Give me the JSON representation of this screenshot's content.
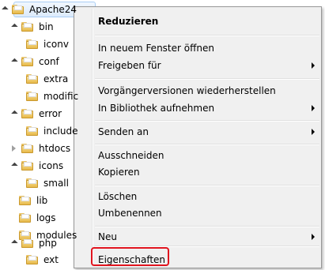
{
  "tree": {
    "items": [
      {
        "label": "Apache24",
        "state": "expanded",
        "selected": true
      },
      {
        "label": "bin",
        "state": "expanded"
      },
      {
        "label": "iconv",
        "state": "none"
      },
      {
        "label": "conf",
        "state": "expanded"
      },
      {
        "label": "extra",
        "state": "none"
      },
      {
        "label": "modific",
        "state": "none"
      },
      {
        "label": "error",
        "state": "expanded"
      },
      {
        "label": "include",
        "state": "none"
      },
      {
        "label": "htdocs",
        "state": "collapsed"
      },
      {
        "label": "icons",
        "state": "expanded"
      },
      {
        "label": "small",
        "state": "none"
      },
      {
        "label": "lib",
        "state": "none"
      },
      {
        "label": "logs",
        "state": "none"
      },
      {
        "label": "modules",
        "state": "none"
      },
      {
        "label": "php",
        "state": "expanded"
      },
      {
        "label": "ext",
        "state": "none"
      }
    ]
  },
  "menu": {
    "items": [
      {
        "label": "Reduzieren",
        "bold": true
      },
      {
        "label": "In neuem Fenster öffnen"
      },
      {
        "label": "Freigeben für",
        "submenu": true
      },
      {
        "label": "Vorgängerversionen wiederherstellen"
      },
      {
        "label": "In Bibliothek aufnehmen",
        "submenu": true
      },
      {
        "label": "Senden an",
        "submenu": true
      },
      {
        "label": "Ausschneiden"
      },
      {
        "label": "Kopieren"
      },
      {
        "label": "Löschen"
      },
      {
        "label": "Umbenennen"
      },
      {
        "label": "Neu",
        "submenu": true
      },
      {
        "label": "Eigenschaften",
        "highlighted": true
      }
    ]
  },
  "colors": {
    "highlight_box": "#e0141e",
    "menu_bg": "#f0f0f0",
    "selection": "#dcebfc"
  }
}
